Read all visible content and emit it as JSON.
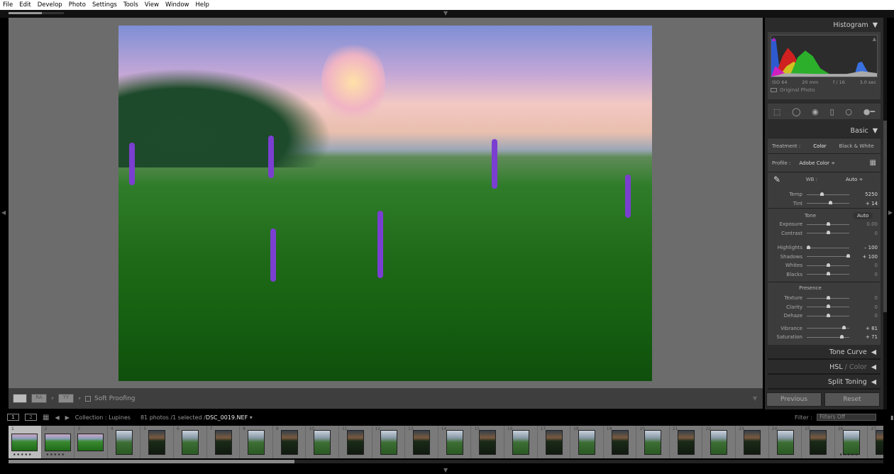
{
  "menu": [
    "File",
    "Edit",
    "Develop",
    "Photo",
    "Settings",
    "Tools",
    "View",
    "Window",
    "Help"
  ],
  "progress_percent": 60,
  "toolbar": {
    "soft_proofing": "Soft Proofing",
    "compare_label": "RA",
    "survey_label": "YY"
  },
  "histogram": {
    "title": "Histogram",
    "iso": "ISO 64",
    "focal": "20 mm",
    "aperture": "f / 16",
    "shutter": "3.0 sec",
    "original_photo": "Original Photo"
  },
  "basic": {
    "title": "Basic",
    "treatment_label": "Treatment :",
    "treatment_color": "Color",
    "treatment_bw": "Black & White",
    "profile_label": "Profile :",
    "profile_value": "Adobe Color ÷",
    "wb_label": "WB :",
    "wb_value": "Auto ÷",
    "tone_label": "Tone",
    "auto_label": "Auto",
    "presence_label": "Presence",
    "wb_sliders": [
      {
        "label": "Temp",
        "value": "5250",
        "pos": 0.35
      },
      {
        "label": "Tint",
        "value": "+ 14",
        "pos": 0.55
      }
    ],
    "tone_sliders": [
      {
        "label": "Exposure",
        "value": "0.00",
        "pos": 0.5
      },
      {
        "label": "Contrast",
        "value": "0",
        "pos": 0.5
      }
    ],
    "tone_sliders2": [
      {
        "label": "Highlights",
        "value": "– 100",
        "pos": 0.04
      },
      {
        "label": "Shadows",
        "value": "+ 100",
        "pos": 0.96
      },
      {
        "label": "Whites",
        "value": "0",
        "pos": 0.5
      },
      {
        "label": "Blacks",
        "value": "0",
        "pos": 0.5
      }
    ],
    "presence_sliders": [
      {
        "label": "Texture",
        "value": "0",
        "pos": 0.5
      },
      {
        "label": "Clarity",
        "value": "0",
        "pos": 0.5
      },
      {
        "label": "Dehaze",
        "value": "0",
        "pos": 0.5
      }
    ],
    "presence_sliders2": [
      {
        "label": "Vibrance",
        "value": "+ 81",
        "pos": 0.86
      },
      {
        "label": "Saturation",
        "value": "+ 71",
        "pos": 0.82
      }
    ]
  },
  "panels": {
    "tone_curve": "Tone Curve",
    "hsl": "HSL",
    "hsl_sep": "/",
    "color": "Color",
    "split_toning": "Split Toning"
  },
  "buttons": {
    "previous": "Previous",
    "reset": "Reset"
  },
  "filmstrip": {
    "view1": "1",
    "view2": "2",
    "collection": "Collection : Lupines",
    "count": "81 photos /1 selected /",
    "filename": "DSC_0019.NEF",
    "filter_label": "Filter :",
    "filter_value": "Filters Off"
  },
  "thumbs": [
    {
      "n": "1",
      "o": "l",
      "tone": "light",
      "stars": "★★★★★",
      "sel": true
    },
    {
      "n": "2",
      "o": "l",
      "tone": "light",
      "stars": "★★★★★"
    },
    {
      "n": "3",
      "o": "l",
      "tone": "light"
    },
    {
      "n": "4",
      "o": "p",
      "tone": "light"
    },
    {
      "n": "5",
      "o": "p",
      "tone": "dark"
    },
    {
      "n": "6",
      "o": "p",
      "tone": "light"
    },
    {
      "n": "7",
      "o": "p",
      "tone": "dark"
    },
    {
      "n": "8",
      "o": "p",
      "tone": "light"
    },
    {
      "n": "9",
      "o": "p",
      "tone": "dark"
    },
    {
      "n": "10",
      "o": "p",
      "tone": "light"
    },
    {
      "n": "11",
      "o": "p",
      "tone": "dark"
    },
    {
      "n": "12",
      "o": "p",
      "tone": "light"
    },
    {
      "n": "13",
      "o": "p",
      "tone": "dark"
    },
    {
      "n": "14",
      "o": "p",
      "tone": "light"
    },
    {
      "n": "15",
      "o": "p",
      "tone": "dark"
    },
    {
      "n": "16",
      "o": "p",
      "tone": "light"
    },
    {
      "n": "17",
      "o": "p",
      "tone": "dark"
    },
    {
      "n": "18",
      "o": "p",
      "tone": "light"
    },
    {
      "n": "19",
      "o": "p",
      "tone": "dark"
    },
    {
      "n": "20",
      "o": "p",
      "tone": "light"
    },
    {
      "n": "21",
      "o": "p",
      "tone": "dark"
    },
    {
      "n": "22",
      "o": "p",
      "tone": "light"
    },
    {
      "n": "23",
      "o": "p",
      "tone": "dark"
    },
    {
      "n": "24",
      "o": "p",
      "tone": "light"
    },
    {
      "n": "25",
      "o": "p",
      "tone": "dark"
    },
    {
      "n": "26",
      "o": "p",
      "tone": "light",
      "stars": "★★★★★"
    },
    {
      "n": "27",
      "o": "p",
      "tone": "dark"
    }
  ],
  "colors": {
    "accent_panel": "#3c3c3c",
    "canvas": "#6c6c6c"
  }
}
